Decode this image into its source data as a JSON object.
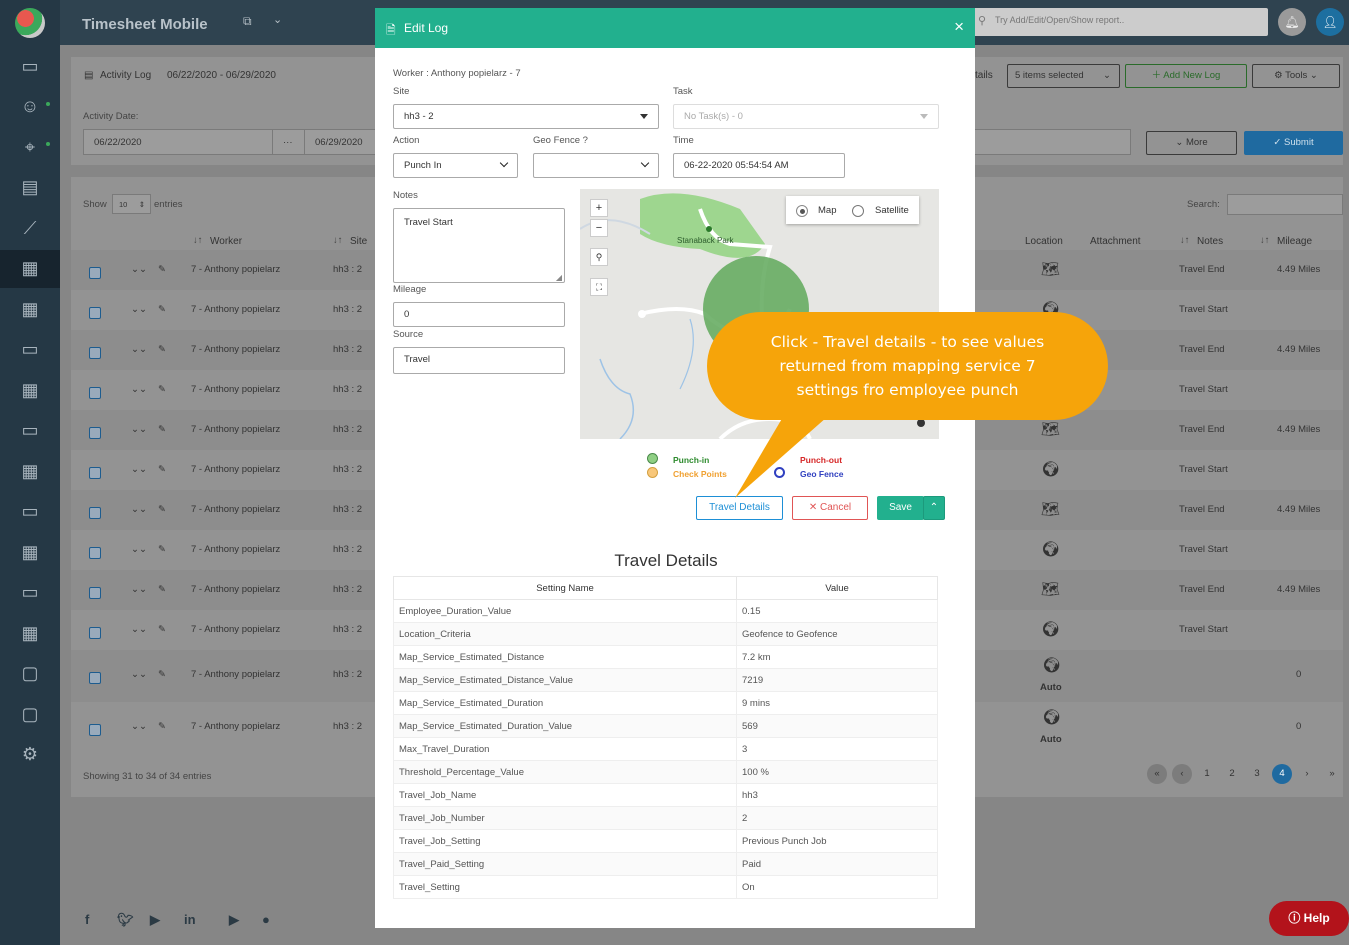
{
  "app": {
    "title": "Timesheet Mobile",
    "search_placeholder": "Try Add/Edit/Open/Show report..",
    "help_label": "Help"
  },
  "sidebar": {
    "icons": [
      "dashboard-icon",
      "workers-icon",
      "geo-users-icon",
      "reports-icon",
      "analytics-icon",
      "activity-log-icon",
      "calendar-15-icon",
      "message-icon",
      "calendar-15-icon",
      "message-icon",
      "calendar-15-icon",
      "message-icon",
      "calendar-15-icon",
      "message-icon",
      "calendar-15-icon",
      "chat-icon",
      "sms-icon",
      "settings-icon"
    ]
  },
  "page": {
    "header": {
      "title": "Activity Log",
      "range": "06/22/2020 - 06/29/2020",
      "details_label": "tails",
      "selected_label": "5 items selected",
      "add_label": "Add New Log",
      "tools_label": "Tools"
    },
    "filter": {
      "date_label": "Activity Date:",
      "from": "06/22/2020",
      "dots": "···",
      "to": "06/29/2020",
      "more_label": "More",
      "submit_label": "Submit"
    },
    "table": {
      "show": "Show",
      "entries_value": "10",
      "entries": "entries",
      "search_label": "Search:",
      "headers": {
        "worker": "Worker",
        "site": "Site",
        "location": "Location",
        "attachment": "Attachment",
        "notes": "Notes",
        "mileage": "Mileage"
      },
      "rows": [
        {
          "worker": "7 - Anthony popielarz",
          "site": "hh3 : 2",
          "notes": "Travel End",
          "mileage": "4.49 Miles"
        },
        {
          "worker": "7 - Anthony popielarz",
          "site": "hh3 : 2",
          "notes": "Travel Start",
          "mileage": ""
        },
        {
          "worker": "7 - Anthony popielarz",
          "site": "hh3 : 2",
          "notes": "Travel End",
          "mileage": "4.49 Miles"
        },
        {
          "worker": "7 - Anthony popielarz",
          "site": "hh3 : 2",
          "notes": "Travel Start",
          "mileage": ""
        },
        {
          "worker": "7 - Anthony popielarz",
          "site": "hh3 : 2",
          "notes": "Travel End",
          "mileage": "4.49 Miles"
        },
        {
          "worker": "7 - Anthony popielarz",
          "site": "hh3 : 2",
          "notes": "Travel Start",
          "mileage": ""
        },
        {
          "worker": "7 - Anthony popielarz",
          "site": "hh3 : 2",
          "notes": "Travel End",
          "mileage": "4.49 Miles"
        },
        {
          "worker": "7 - Anthony popielarz",
          "site": "hh3 : 2",
          "notes": "Travel Start",
          "mileage": ""
        },
        {
          "worker": "7 - Anthony popielarz",
          "site": "hh3 : 2",
          "notes": "Travel End",
          "mileage": "4.49 Miles"
        },
        {
          "worker": "7 - Anthony popielarz",
          "site": "hh3 : 2",
          "notes": "Travel Start",
          "mileage": ""
        },
        {
          "worker": "7 - Anthony popielarz",
          "site": "hh3 : 2",
          "notes": "",
          "mileage": "0",
          "auto": "Auto"
        },
        {
          "worker": "7 - Anthony popielarz",
          "site": "hh3 : 2",
          "notes": "",
          "mileage": "0",
          "auto": "Auto"
        }
      ],
      "footer": "Showing 31 to 34 of 34 entries",
      "pages": [
        "1",
        "2",
        "3",
        "4"
      ]
    }
  },
  "modal": {
    "title": "Edit Log",
    "worker": "Worker : Anthony popielarz - 7",
    "site_label": "Site",
    "site_value": "hh3 - 2",
    "task_label": "Task",
    "task_value": "No Task(s) - 0",
    "action_label": "Action",
    "action_value": "Punch In",
    "geofence_label": "Geo Fence ?",
    "geofence_value": "",
    "time_label": "Time",
    "time_value": "06-22-2020 05:54:54 AM",
    "notes_label": "Notes",
    "notes_value": "Travel Start",
    "mileage_label": "Mileage",
    "mileage_value": "0",
    "source_label": "Source",
    "source_value": "Travel",
    "map": {
      "map_label": "Map",
      "satellite_label": "Satellite",
      "park_label": "Stanaback Park",
      "zoom_in": "+",
      "zoom_out": "−"
    },
    "legend": {
      "punch_in": "Punch-in",
      "punch_out": "Punch-out",
      "check_points": "Check Points",
      "geo_fence": "Geo Fence"
    },
    "buttons": {
      "travel_details": "Travel Details",
      "cancel": "Cancel",
      "save": "Save"
    },
    "travel_details": {
      "title": "Travel Details",
      "col_setting": "Setting Name",
      "col_value": "Value",
      "rows": [
        {
          "name": "Employee_Duration_Value",
          "value": "0.15"
        },
        {
          "name": "Location_Criteria",
          "value": "Geofence to Geofence"
        },
        {
          "name": "Map_Service_Estimated_Distance",
          "value": "7.2 km"
        },
        {
          "name": "Map_Service_Estimated_Distance_Value",
          "value": "7219"
        },
        {
          "name": "Map_Service_Estimated_Duration",
          "value": "9 mins"
        },
        {
          "name": "Map_Service_Estimated_Duration_Value",
          "value": "569"
        },
        {
          "name": "Max_Travel_Duration",
          "value": "3"
        },
        {
          "name": "Threshold_Percentage_Value",
          "value": "100 %"
        },
        {
          "name": "Travel_Job_Name",
          "value": "hh3"
        },
        {
          "name": "Travel_Job_Number",
          "value": "2"
        },
        {
          "name": "Travel_Job_Setting",
          "value": "Previous Punch Job"
        },
        {
          "name": "Travel_Paid_Setting",
          "value": "Paid"
        },
        {
          "name": "Travel_Setting",
          "value": "On"
        }
      ]
    }
  },
  "callout": {
    "line1": "Click - Travel details - to see values",
    "line2": "returned from mapping service 7",
    "line3": "settings fro employee punch"
  },
  "colors": {
    "modal_header": "#22b08e",
    "callout": "#f6a40a",
    "primary": "#1d8fd6",
    "cancel": "#e05555",
    "punch_in": "#2e8b2e",
    "punch_out": "#d62828",
    "check_points": "#f0a030",
    "geo_fence": "#3040c0"
  }
}
